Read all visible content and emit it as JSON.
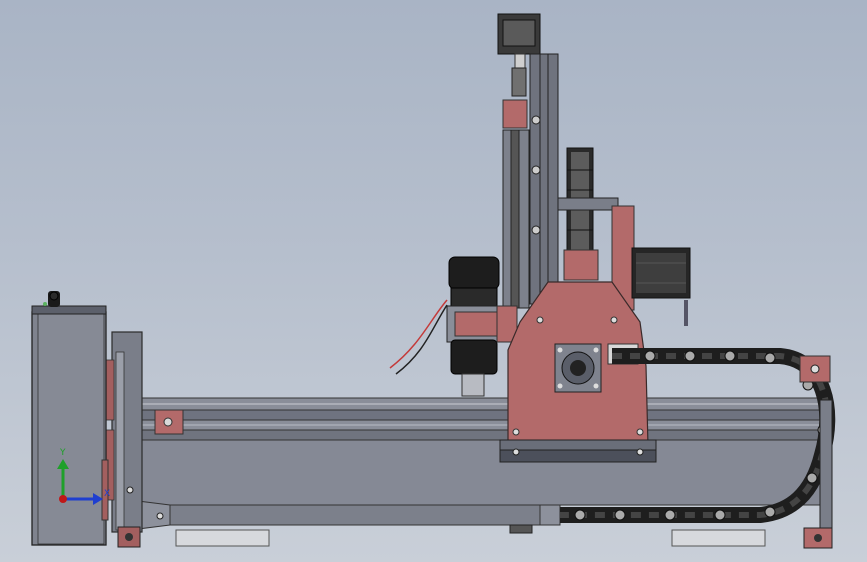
{
  "viewport": {
    "background_top": "#a9b4c5",
    "background_bottom": "#c9cfd8"
  },
  "colors": {
    "frame_gray": "#7b7f8b",
    "frame_dark": "#4d515c",
    "plate_red": "#b36a6a",
    "plate_red_dark": "#8c4a4a",
    "motor_black": "#232323",
    "chain_black": "#1e1e1e",
    "axis_y": "#1fa02a",
    "axis_x": "#1f3fd0",
    "axis_origin": "#c01818"
  },
  "triad": {
    "y_label": "Y",
    "x_label": "X"
  },
  "icons": [
    "reference-triad-icon",
    "stepper-motor-icon",
    "spindle-icon",
    "cable-chain-icon",
    "control-box-icon"
  ]
}
